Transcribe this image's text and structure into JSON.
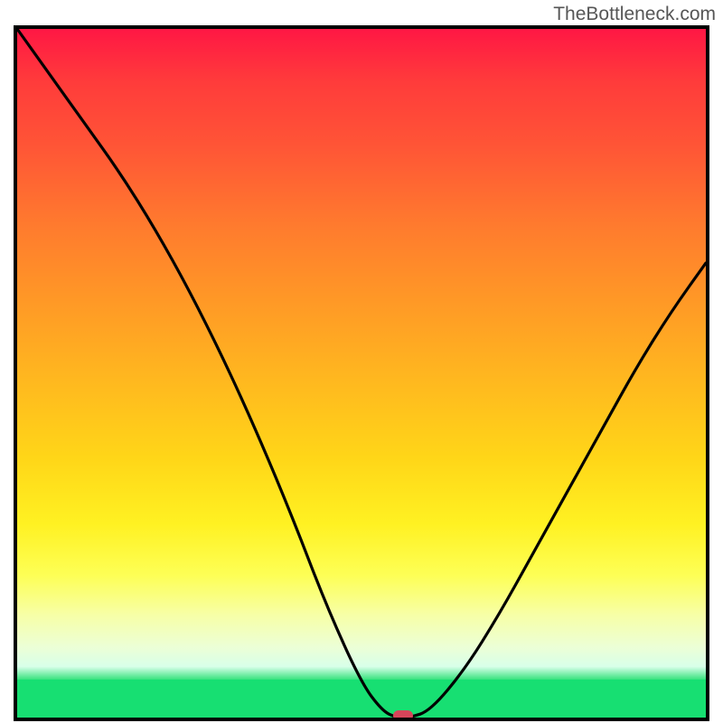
{
  "watermark": "TheBottleneck.com",
  "chart_data": {
    "type": "line",
    "title": "",
    "xlabel": "",
    "ylabel": "",
    "xlim": [
      0,
      100
    ],
    "ylim": [
      0,
      100
    ],
    "x": [
      0,
      5,
      10,
      15,
      20,
      25,
      30,
      35,
      40,
      45,
      50,
      53,
      55,
      57,
      60,
      65,
      70,
      75,
      80,
      85,
      90,
      95,
      100
    ],
    "y": [
      100,
      93,
      86,
      79,
      71,
      62,
      52,
      41,
      29,
      16,
      5,
      1,
      0,
      0,
      1,
      7,
      15,
      24,
      33,
      42,
      51,
      59,
      66
    ],
    "marker_x": 56,
    "marker_y": 0,
    "gradient_colors_top_to_bottom": [
      "#ff1744",
      "#ff7a2e",
      "#ffd618",
      "#fdff56",
      "#17df72"
    ]
  }
}
